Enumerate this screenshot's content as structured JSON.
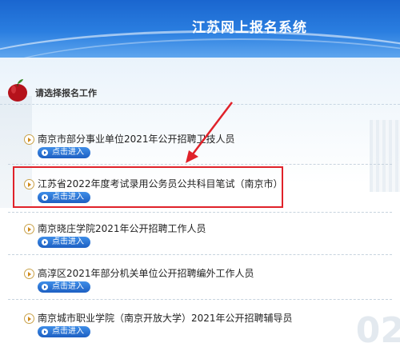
{
  "header": {
    "title": "江苏网上报名系统"
  },
  "section": {
    "title": "请选择报名工作"
  },
  "items": [
    {
      "label": "南京市部分事业单位2021年公开招聘卫技人员",
      "enter_label": "点击进入"
    },
    {
      "label": "江苏省2022年度考试录用公务员公共科目笔试（南京市）",
      "enter_label": "点击进入",
      "highlighted": true
    },
    {
      "label": "南京晓庄学院2021年公开招聘工作人员",
      "enter_label": "点击进入"
    },
    {
      "label": "高淳区2021年部分机关单位公开招聘编外工作人员",
      "enter_label": "点击进入"
    },
    {
      "label": "南京城市职业学院（南京开放大学）2021年公开招聘辅导员",
      "enter_label": "点击进入"
    }
  ],
  "decor": {
    "background_number": "02"
  },
  "colors": {
    "header_blue": "#2a7ee0",
    "button_blue": "#1d5fc2",
    "highlight_red": "#e0222a"
  },
  "icons": {
    "section": "apple-icon",
    "bullet": "arrow-bullet-icon"
  }
}
